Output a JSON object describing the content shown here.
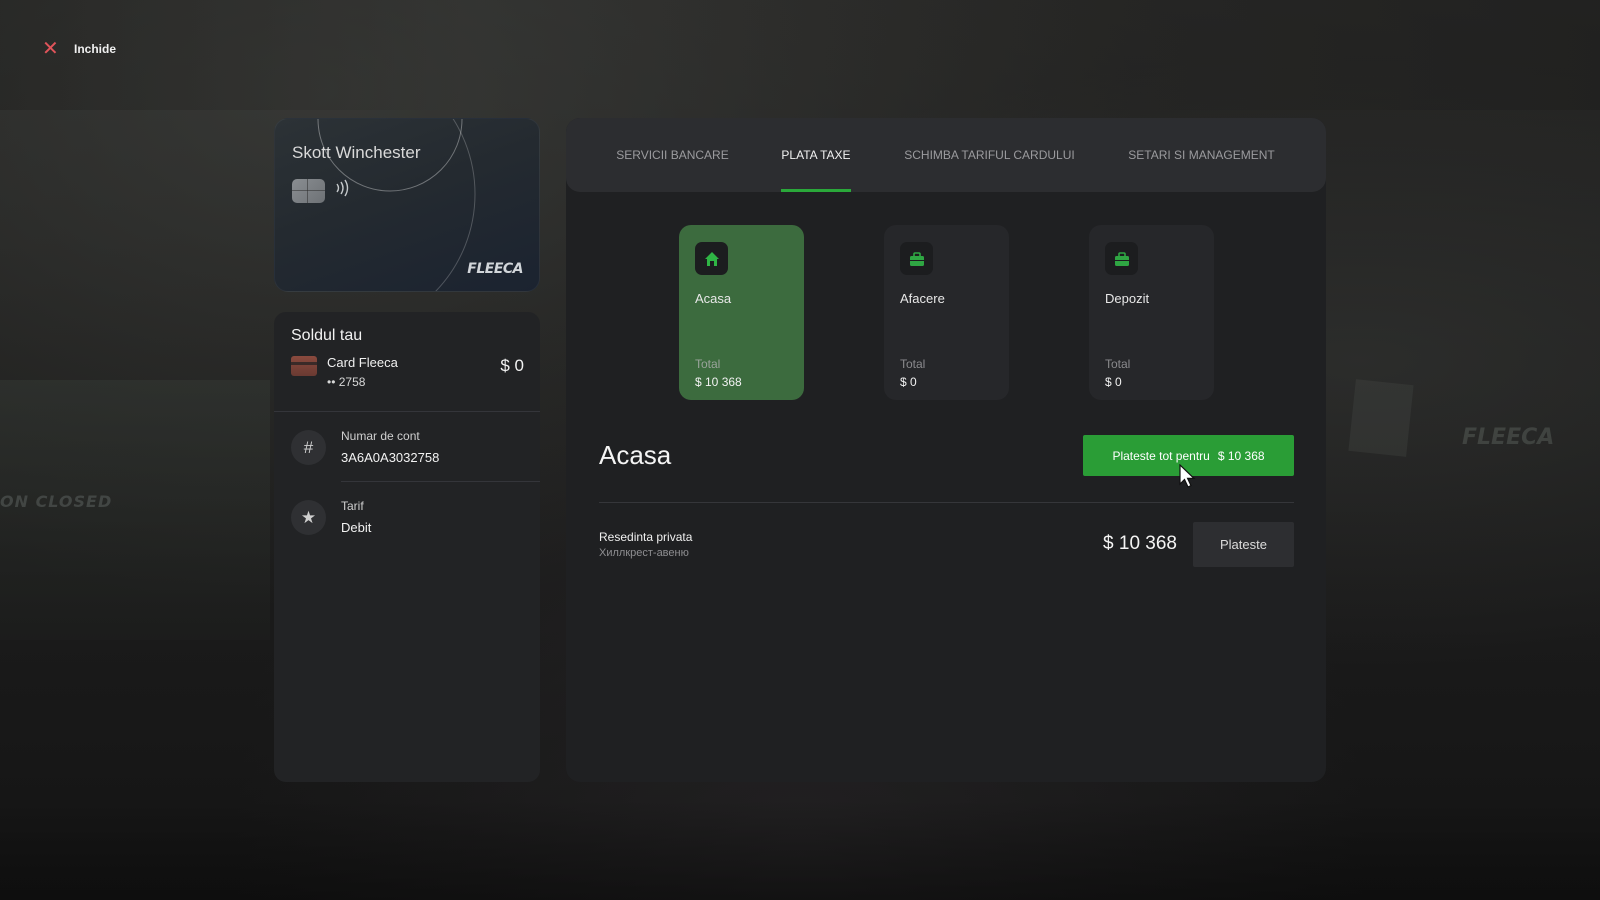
{
  "close": {
    "label": "Inchide"
  },
  "card": {
    "holder": "Skott Winchester",
    "brand": "FLEECA"
  },
  "balance": {
    "title": "Soldul tau",
    "card_name": "Card Fleeca",
    "card_mask": "•• 2758",
    "amount": "$ 0"
  },
  "account": {
    "label": "Numar de cont",
    "value": "3A6A0A3032758"
  },
  "tariff": {
    "label": "Tarif",
    "value": "Debit"
  },
  "tabs": [
    {
      "label": "SERVICII BANCARE"
    },
    {
      "label": "PLATA TAXE",
      "active": true
    },
    {
      "label": "SCHIMBA TARIFUL CARDULUI"
    },
    {
      "label": "SETARI SI MANAGEMENT"
    }
  ],
  "categories": [
    {
      "name": "Acasa",
      "total_label": "Total",
      "total_value": "$ 10 368",
      "icon": "home-icon",
      "active": true
    },
    {
      "name": "Afacere",
      "total_label": "Total",
      "total_value": "$ 0",
      "icon": "briefcase-icon"
    },
    {
      "name": "Depozit",
      "total_label": "Total",
      "total_value": "$ 0",
      "icon": "briefcase-icon"
    }
  ],
  "section": {
    "title": "Acasa",
    "pay_all_label": "Plateste tot pentru",
    "pay_all_amount": "$ 10 368"
  },
  "bills": [
    {
      "name": "Resedinta privata",
      "address": "Хиллкрест-авеню",
      "amount": "$ 10 368",
      "pay_label": "Plateste"
    }
  ],
  "colors": {
    "accent_green": "#2a9d36",
    "active_category": "#3c6b3e",
    "close_red": "#e0545a",
    "panel": "#1f2022"
  }
}
